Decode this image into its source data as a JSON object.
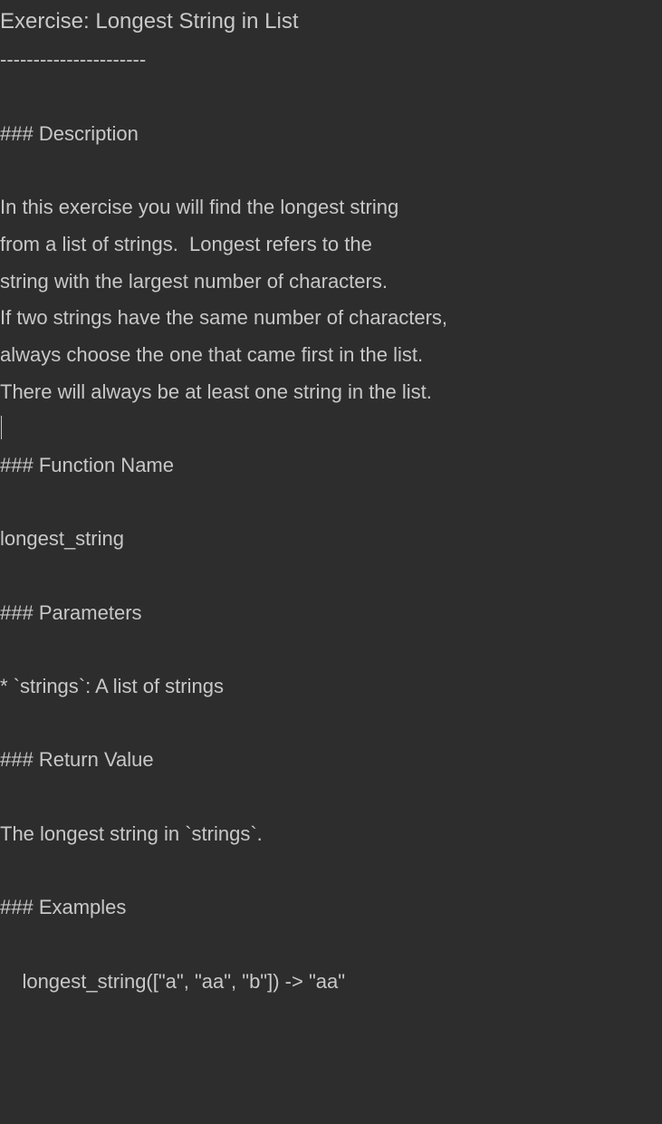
{
  "lines": {
    "l0": "Exercise: Longest String in List",
    "l1": "----------------------",
    "l2": "",
    "l3": "### Description",
    "l4": "",
    "l5": "In this exercise you will find the longest string",
    "l6": "from a list of strings.  Longest refers to the",
    "l7": "string with the largest number of characters.",
    "l8": "If two strings have the same number of characters,",
    "l9": "always choose the one that came first in the list.",
    "l10": "There will always be at least one string in the list.",
    "l11": "",
    "l12": "### Function Name",
    "l13": "",
    "l14": "longest_string",
    "l15": "",
    "l16": "### Parameters",
    "l17": "",
    "l18": "* `strings`: A list of strings",
    "l19": "",
    "l20": "### Return Value",
    "l21": "",
    "l22": "The longest string in `strings`.",
    "l23": "",
    "l24": "### Examples",
    "l25": "",
    "l26": "    longest_string([\"a\", \"aa\", \"b\"]) -> \"aa\""
  }
}
